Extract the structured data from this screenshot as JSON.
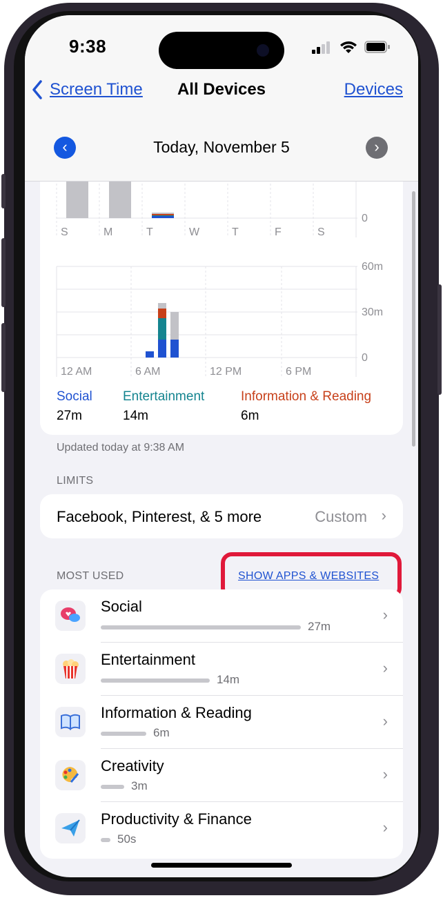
{
  "status": {
    "time": "9:38"
  },
  "nav": {
    "back_label": "Screen Time",
    "title": "All Devices",
    "right_label": "Devices"
  },
  "date": {
    "label": "Today, November 5",
    "prev_icon": "chevron-left-icon",
    "next_icon": "chevron-right-icon"
  },
  "weekly_chart": {
    "days": [
      "S",
      "M",
      "T",
      "W",
      "T",
      "F",
      "S"
    ],
    "y_tick": "0"
  },
  "hourly_chart": {
    "x_ticks": [
      "12 AM",
      "6 AM",
      "12 PM",
      "6 PM"
    ],
    "y_ticks": [
      "60m",
      "30m",
      "0"
    ]
  },
  "legend": [
    {
      "name": "Social",
      "value": "27m",
      "color": "#1f52d1"
    },
    {
      "name": "Entertainment",
      "value": "14m",
      "color": "#14848f"
    },
    {
      "name": "Information & Reading",
      "value": "6m",
      "color": "#c7401a"
    }
  ],
  "updated_text": "Updated today at 9:38 AM",
  "limits": {
    "section_label": "LIMITS",
    "row_title": "Facebook, Pinterest, & 5 more",
    "row_value": "Custom"
  },
  "most_used": {
    "section_label": "MOST USED",
    "toggle_label": "SHOW APPS & WEBSITES",
    "items": [
      {
        "name": "Social",
        "time": "27m",
        "icon": "speech-bubbles-icon"
      },
      {
        "name": "Entertainment",
        "time": "14m",
        "icon": "popcorn-icon"
      },
      {
        "name": "Information & Reading",
        "time": "6m",
        "icon": "book-icon"
      },
      {
        "name": "Creativity",
        "time": "3m",
        "icon": "palette-icon"
      },
      {
        "name": "Productivity & Finance",
        "time": "50s",
        "icon": "paper-plane-icon"
      }
    ]
  },
  "colors": {
    "accent": "#1f52d1",
    "highlight": "#e0193a",
    "bar_gray": "#c7c7cc"
  }
}
